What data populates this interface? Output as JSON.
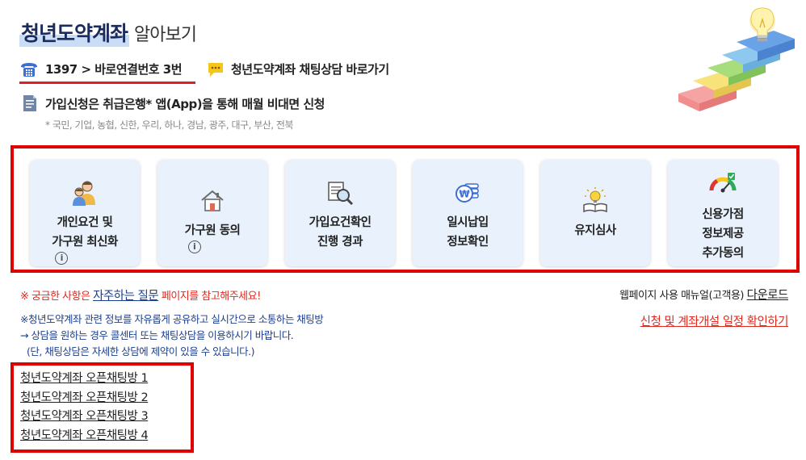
{
  "header": {
    "title_main": "청년도약계좌",
    "title_sub": "알아보기"
  },
  "contact": {
    "phone": "1397 > 바로연결번호 3번",
    "chat_link": "청년도약계좌 채팅상담 바로가기"
  },
  "apply": {
    "text": "가입신청은 취급은행* 앱(App)을 통해 매월 비대면 신청",
    "banks": "* 국민, 기업, 농협, 신한, 우리, 하나, 경남, 광주, 대구, 부산, 전북"
  },
  "cards": [
    {
      "icon": "people-icon",
      "line1": "개인요건 및",
      "line2": "가구원 최신화",
      "info": "i"
    },
    {
      "icon": "house-icon",
      "line1": "가구원 동의",
      "info": "i"
    },
    {
      "icon": "document-search-icon",
      "line1": "가입요건확인",
      "line2": "진행 경과"
    },
    {
      "icon": "coin-icon",
      "line1": "일시납입",
      "line2": "정보확인"
    },
    {
      "icon": "lightbulb-book-icon",
      "line1": "유지심사"
    },
    {
      "icon": "gauge-icon",
      "line1": "신용가점",
      "line2": "정보제공",
      "line3": "추가동의"
    }
  ],
  "faq": {
    "prefix": "※ 궁금한 사항은",
    "link": "자주하는 질문",
    "suffix": "페이지를 참고해주세요!"
  },
  "manual": {
    "text": "웹페이지 사용 매뉴얼(고객용)",
    "link": "다운로드"
  },
  "schedule_link": "신청 및 계좌개설 일정 확인하기",
  "chat_info": [
    "※청년도약계좌 관련 정보를 자유롭게 공유하고 실시간으로 소통하는 채팅방",
    "→ 상담을 원하는 경우 콜센터 또는 채팅상담을 이용하시기 바랍니다.",
    "(단, 채팅상담은 자세한 상담에 제약이 있을 수 있습니다.)"
  ],
  "openchats": [
    "청년도약계좌 오픈채팅방 1",
    "청년도약계좌 오픈채팅방 2",
    "청년도약계좌 오픈채팅방 3",
    "청년도약계좌 오픈채팅방 4"
  ],
  "colors": {
    "accent_red": "#e00000",
    "navy": "#1b2b5e",
    "link_blue": "#1c3f8f",
    "card_bg": "#e9f2fc"
  }
}
